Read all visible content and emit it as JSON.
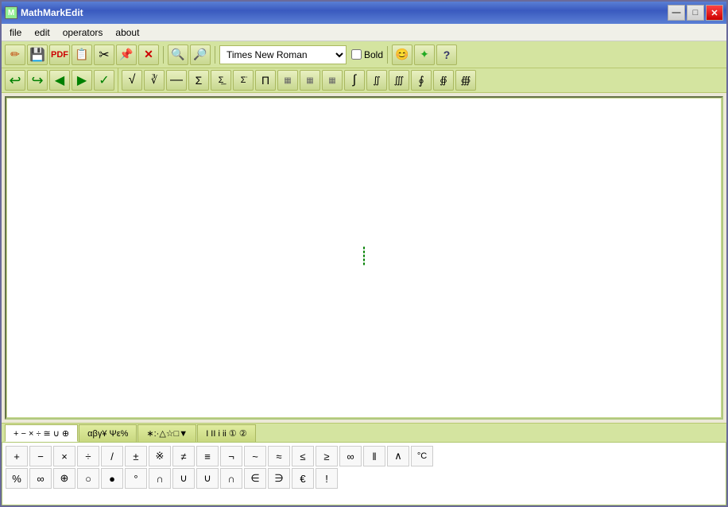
{
  "window": {
    "title": "MathMarkEdit"
  },
  "titleButtons": {
    "minimize": "—",
    "maximize": "□",
    "close": "✕"
  },
  "menuBar": {
    "items": [
      "file",
      "edit",
      "operators",
      "about"
    ]
  },
  "toolbar": {
    "fontName": "Times New Roman",
    "boldLabel": "Bold",
    "icons": {
      "pencil": "✏",
      "save": "💾",
      "pdf": "📄",
      "copy": "📋",
      "scissors": "✂",
      "paste": "📌",
      "delete": "✕",
      "zoomIn": "🔍",
      "zoomOut": "🔎",
      "smiley": "😊",
      "star": "✦",
      "help": "?"
    }
  },
  "mathToolbar": {
    "buttons": [
      "√",
      "∛",
      "—",
      "Σ",
      "Σ",
      "Σ",
      "Π",
      "▦",
      "▦",
      "▦",
      "∫",
      "∫∫",
      "∫∫∫",
      "∮",
      "∯",
      "∰"
    ]
  },
  "undoToolbar": {
    "buttons": [
      "↩",
      "↪",
      "◀",
      "▶",
      "✓"
    ]
  },
  "symbolTabs": {
    "tabs": [
      {
        "id": "arith",
        "label": "+ − × ÷ ≅ ∪ ⊕",
        "active": true
      },
      {
        "id": "greek",
        "label": "αβγ¥ Ψε%"
      },
      {
        "id": "special",
        "label": "∗:·△☆□▼"
      },
      {
        "id": "roman",
        "label": "I II i ii ① ②"
      }
    ]
  },
  "symbolPanel": {
    "row1": [
      "+",
      "−",
      "×",
      "÷",
      "/",
      "±",
      "※",
      "≠",
      "≡",
      "¬",
      "~",
      "≈",
      "≤",
      "≥",
      "∞",
      "‖",
      "∧",
      "°C"
    ],
    "row2": [
      "%",
      "∞",
      "⊕",
      "○",
      "●",
      "○",
      "∩",
      "∪",
      "∪",
      "∩",
      "∈",
      "∋",
      "€",
      "!"
    ]
  }
}
